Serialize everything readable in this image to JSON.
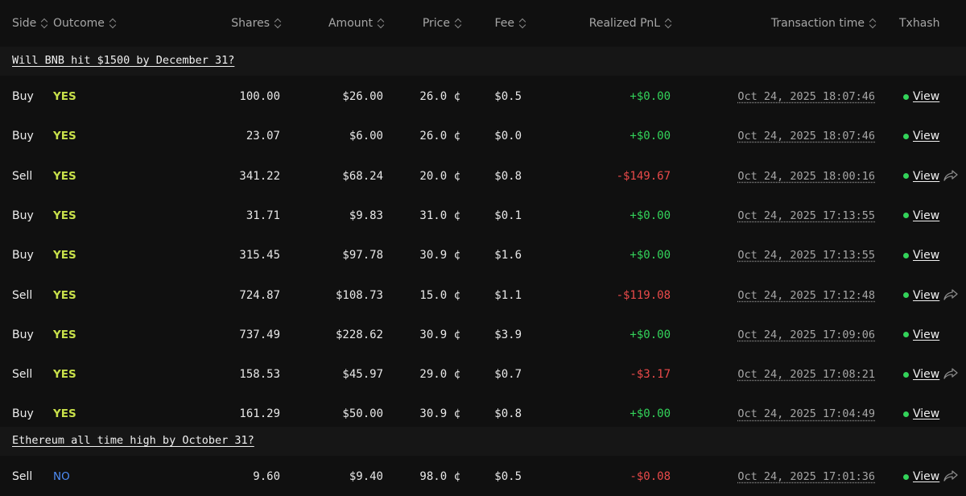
{
  "columns": {
    "side": "Side",
    "outcome": "Outcome",
    "shares": "Shares",
    "amount": "Amount",
    "price": "Price",
    "fee": "Fee",
    "realized_pnl": "Realized PnL",
    "transaction_time": "Transaction time",
    "txhash": "Txhash"
  },
  "colors": {
    "yes": "#c8e04a",
    "no": "#4e8cf5",
    "positive": "#33d35a",
    "negative": "#ea4a4a",
    "status_dot": "#33d35a"
  },
  "groups": [
    {
      "title": "Will BNB hit $1500 by December 31?",
      "rows": [
        {
          "side": "Buy",
          "outcome": "YES",
          "shares": "100.00",
          "amount": "$26.00",
          "price": "26.0 ¢",
          "fee": "$0.5",
          "pnl": "+$0.00",
          "pnl_sign": "pos",
          "time": "Oct 24, 2025 18:07:46",
          "tx": "View",
          "share": false
        },
        {
          "side": "Buy",
          "outcome": "YES",
          "shares": "23.07",
          "amount": "$6.00",
          "price": "26.0 ¢",
          "fee": "$0.0",
          "pnl": "+$0.00",
          "pnl_sign": "pos",
          "time": "Oct 24, 2025 18:07:46",
          "tx": "View",
          "share": false
        },
        {
          "side": "Sell",
          "outcome": "YES",
          "shares": "341.22",
          "amount": "$68.24",
          "price": "20.0 ¢",
          "fee": "$0.8",
          "pnl": "-$149.67",
          "pnl_sign": "neg",
          "time": "Oct 24, 2025 18:00:16",
          "tx": "View",
          "share": true
        },
        {
          "side": "Buy",
          "outcome": "YES",
          "shares": "31.71",
          "amount": "$9.83",
          "price": "31.0 ¢",
          "fee": "$0.1",
          "pnl": "+$0.00",
          "pnl_sign": "pos",
          "time": "Oct 24, 2025 17:13:55",
          "tx": "View",
          "share": false
        },
        {
          "side": "Buy",
          "outcome": "YES",
          "shares": "315.45",
          "amount": "$97.78",
          "price": "30.9 ¢",
          "fee": "$1.6",
          "pnl": "+$0.00",
          "pnl_sign": "pos",
          "time": "Oct 24, 2025 17:13:55",
          "tx": "View",
          "share": false
        },
        {
          "side": "Sell",
          "outcome": "YES",
          "shares": "724.87",
          "amount": "$108.73",
          "price": "15.0 ¢",
          "fee": "$1.1",
          "pnl": "-$119.08",
          "pnl_sign": "neg",
          "time": "Oct 24, 2025 17:12:48",
          "tx": "View",
          "share": true
        },
        {
          "side": "Buy",
          "outcome": "YES",
          "shares": "737.49",
          "amount": "$228.62",
          "price": "30.9 ¢",
          "fee": "$3.9",
          "pnl": "+$0.00",
          "pnl_sign": "pos",
          "time": "Oct 24, 2025 17:09:06",
          "tx": "View",
          "share": false
        },
        {
          "side": "Sell",
          "outcome": "YES",
          "shares": "158.53",
          "amount": "$45.97",
          "price": "29.0 ¢",
          "fee": "$0.7",
          "pnl": "-$3.17",
          "pnl_sign": "neg",
          "time": "Oct 24, 2025 17:08:21",
          "tx": "View",
          "share": true
        },
        {
          "side": "Buy",
          "outcome": "YES",
          "shares": "161.29",
          "amount": "$50.00",
          "price": "30.9 ¢",
          "fee": "$0.8",
          "pnl": "+$0.00",
          "pnl_sign": "pos",
          "time": "Oct 24, 2025 17:04:49",
          "tx": "View",
          "share": false
        }
      ]
    },
    {
      "title": "Ethereum all time high by October 31?",
      "rows": [
        {
          "side": "Sell",
          "outcome": "NO",
          "shares": "9.60",
          "amount": "$9.40",
          "price": "98.0 ¢",
          "fee": "$0.5",
          "pnl": "-$0.08",
          "pnl_sign": "neg",
          "time": "Oct 24, 2025 17:01:36",
          "tx": "View",
          "share": true
        }
      ]
    }
  ]
}
